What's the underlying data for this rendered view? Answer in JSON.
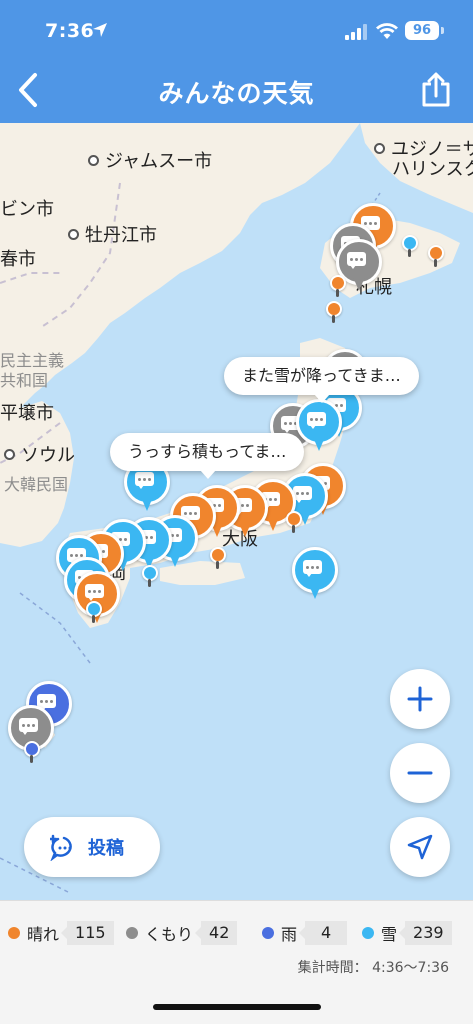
{
  "status_bar": {
    "time": "7:36",
    "battery": "96"
  },
  "nav": {
    "title": "みんなの天気"
  },
  "map": {
    "labels": {
      "jamusu": "ジャムスー市",
      "yuzhno": "ユジノ＝サ",
      "haris": "ハリンスク",
      "bin": "ビン市",
      "botan": "牡丹江市",
      "haru": "春市",
      "sapporo": "札幌",
      "minshu": "民主主義",
      "kyowa": "共和国",
      "pyeong": "平壌市",
      "seoul": "ソウル",
      "daekan": "大韓民国",
      "osaka": "大阪",
      "oka": "岡"
    },
    "callouts": [
      {
        "text": "また雪が降ってきま…"
      },
      {
        "text": "うっすら積もってま…"
      }
    ],
    "colors": {
      "sunny": "#f0852d",
      "cloudy": "#8d8d8d",
      "rain": "#4a6fe0",
      "snow": "#3bb7f2"
    }
  },
  "controls": {
    "post_label": "投稿"
  },
  "legend": {
    "items": [
      {
        "label": "晴れ",
        "count": "115",
        "color": "#f0852d"
      },
      {
        "label": "くもり",
        "count": "42",
        "color": "#8d8d8d"
      },
      {
        "label": "雨",
        "count": "4",
        "color": "#4a6fe0"
      },
      {
        "label": "雪",
        "count": "239",
        "color": "#3bb7f2"
      }
    ],
    "tally_time": "集計時間：  4:36〜7:36"
  }
}
